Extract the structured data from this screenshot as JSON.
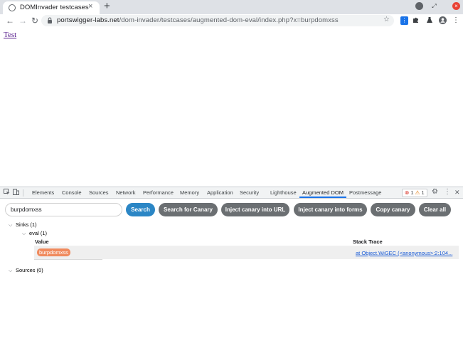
{
  "browser": {
    "tab_title": "DOMInvader testcases",
    "new_tab_label": "+",
    "url_host": "portswigger-labs.net",
    "url_path": "/dom-invader/testcases/augmented-dom-eval/index.php?x=burpdomxss",
    "back_glyph": "←",
    "forward_glyph": "→",
    "reload_glyph": "↻",
    "lock_glyph": "🔒",
    "star_glyph": "☆",
    "menu_glyph": "⋮",
    "close_glyph": "×",
    "icons": [
      "globe-icon",
      "lock-icon",
      "star-icon",
      "extension-icon",
      "puzzle-icon",
      "flask-icon",
      "profile-icon",
      "menu-icon"
    ]
  },
  "page": {
    "link_text": "Test"
  },
  "devtools": {
    "tabs": [
      "Elements",
      "Console",
      "Sources",
      "Network",
      "Performance",
      "Memory",
      "Application",
      "Security",
      "Lighthouse",
      "Augmented DOM",
      "Postmessage"
    ],
    "active_tab": "Augmented DOM",
    "issues_errors": "1",
    "issues_warnings": "1",
    "error_glyph": "⊗",
    "warning_glyph": "⚠",
    "settings_glyph": "⚙",
    "close_glyph": "✕"
  },
  "augmented_dom": {
    "search_value": "burpdomxss",
    "buttons": {
      "search": "Search",
      "search_canary": "Search for Canary",
      "inject_url": "Inject canary into URL",
      "inject_forms": "Inject canary into forms",
      "copy_canary": "Copy canary",
      "clear_all": "Clear all"
    },
    "sinks_label": "Sinks (1)",
    "eval_label": "eval (1)",
    "value_header": "Value",
    "stack_header": "Stack Trace",
    "row_value": "burpdomxss",
    "row_stack": "at Object.WiGEC (<anonymous>:2:104...",
    "sources_label": "Sources (0)"
  },
  "colors": {
    "primary_button": "#2b86c5",
    "secondary_button": "#6b6f72",
    "canary_badge": "#f08a5d",
    "link": "#1558d6"
  }
}
